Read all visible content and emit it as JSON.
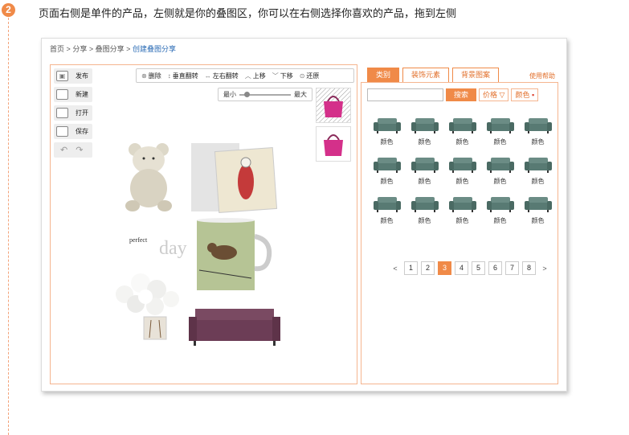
{
  "step": {
    "number": "2",
    "instruction": "页面右侧是单件的产品，左侧就是你的叠图区，你可以在右侧选择你喜欢的产品，拖到左侧"
  },
  "breadcrumb": {
    "home": "首页",
    "share": "分享",
    "collage_share": "叠图分享",
    "current": "创建叠图分享",
    "separator": ">"
  },
  "toolbar": {
    "publish": "发布",
    "new": "新建",
    "open": "打开",
    "save": "保存"
  },
  "edit_bar": {
    "delete": "删除",
    "flip_v": "垂直翻转",
    "flip_h": "左右翻转",
    "up": "上移",
    "down": "下移",
    "restore": "还原"
  },
  "zoom": {
    "min": "最小",
    "max": "最大",
    "level": 0.1
  },
  "canvas_text": {
    "perfect": "perfect",
    "day": "day"
  },
  "tabs": [
    "类别",
    "装饰元素",
    "背景图案"
  ],
  "help": "使用帮助",
  "search": {
    "button": "搜索",
    "price": "价格",
    "color": "颜色"
  },
  "products": [
    "颜色",
    "颜色",
    "颜色",
    "颜色",
    "颜色",
    "颜色",
    "颜色",
    "颜色",
    "颜色",
    "颜色",
    "颜色",
    "颜色",
    "颜色",
    "颜色",
    "颜色"
  ],
  "pagination": {
    "prev": "<",
    "next": ">",
    "pages": [
      "1",
      "2",
      "3",
      "4",
      "5",
      "6",
      "7",
      "8"
    ],
    "current": "3"
  },
  "colors": {
    "accent": "#f08a48",
    "border": "#f5b58f",
    "link": "#2a6bb5",
    "sofa": "#5f7f78"
  }
}
